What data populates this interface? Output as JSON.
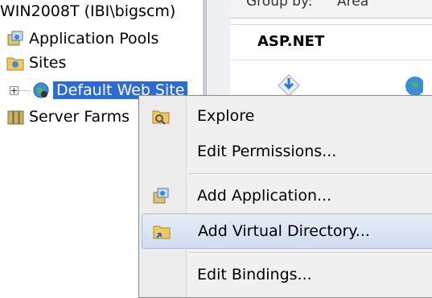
{
  "tree": {
    "server": "WIN2008T (IBI\\bigscm)",
    "items": [
      {
        "label": "Application Pools",
        "icon": "application-pools-icon"
      },
      {
        "label": "Sites",
        "icon": "sites-folder-icon"
      },
      {
        "label": "Default Web Site",
        "icon": "globe-icon",
        "selected": true
      },
      {
        "label": "Server Farms",
        "icon": "server-farms-icon"
      }
    ]
  },
  "right_pane": {
    "group_by_label": "Group by:",
    "group_by_value": "Area",
    "section_title": "ASP.NET"
  },
  "context_menu": {
    "items": [
      {
        "label": "Explore",
        "icon": "explore-folder-icon"
      },
      {
        "label": "Edit Permissions..."
      },
      {
        "label": "Add Application...",
        "icon": "add-application-icon"
      },
      {
        "label": "Add Virtual Directory...",
        "icon": "add-virtual-directory-icon",
        "highlighted": true
      },
      {
        "label": "Edit Bindings..."
      }
    ]
  },
  "colors": {
    "selection": "#2a6bd5",
    "menu_highlight": "#cfdcee"
  }
}
